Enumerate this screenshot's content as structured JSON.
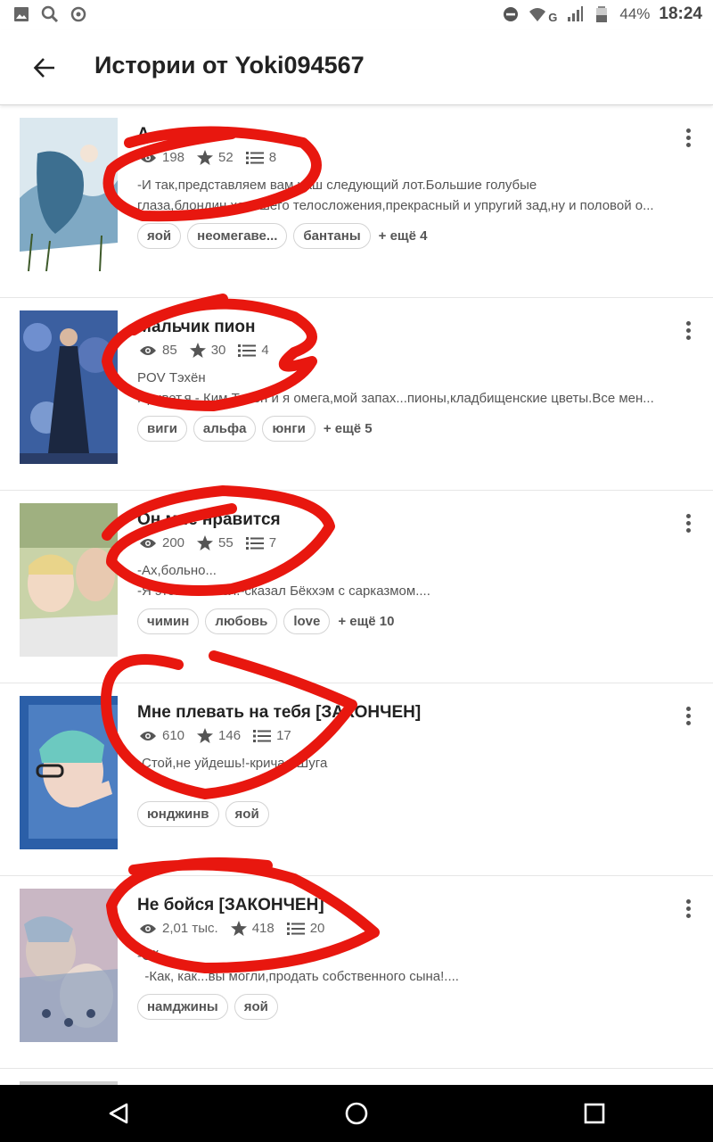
{
  "status_bar": {
    "battery": "44%",
    "time": "18:24",
    "network": "G"
  },
  "app_bar": {
    "title": "Истории от Yoki094567"
  },
  "stories": [
    {
      "title": "А...",
      "views": "198",
      "votes": "52",
      "parts": "8",
      "description": [
        "-И так,представляем вам наш следующий лот.Большие голубые",
        "глаза,блондин,хорошего телосложения,прекрасный и упругий зад,ну и половой о..."
      ],
      "tags": [
        "яой",
        "неомегаве...",
        "бантаны"
      ],
      "more_tags": "+ ещё 4",
      "cover_colors": [
        "#cfe0ea",
        "#6b9ab8",
        "#2f5f7f"
      ]
    },
    {
      "title": "Мальчик пион",
      "views": "85",
      "votes": "30",
      "parts": "4",
      "description": [
        "POV Тэхён",
        "Привет,я - Ким Тэхён и я омега,мой запах...пионы,кладбищенские цветы.Все мен..."
      ],
      "tags": [
        "виги",
        "альфа",
        "юнги"
      ],
      "more_tags": "+ ещё 5",
      "cover_colors": [
        "#3b5fa0",
        "#7b9ad0",
        "#1b2740"
      ]
    },
    {
      "title": "Он мне нравится",
      "views": "200",
      "votes": "55",
      "parts": "7",
      "description": [
        "-Ах,больно...",
        "-Я этого и хотел.-сказал Бёкхэм с сарказмом...."
      ],
      "tags": [
        "чимин",
        "любовь",
        "love"
      ],
      "more_tags": "+ ещё 10",
      "cover_colors": [
        "#c9d3a8",
        "#f2d9c4",
        "#e8e8e8"
      ]
    },
    {
      "title": "Мне плевать на тебя [ЗАКОНЧЕН]",
      "views": "610",
      "votes": "146",
      "parts": "17",
      "description": [
        "-Стой,не уйдешь!-кричал Шуга"
      ],
      "tags": [
        "юнджинв",
        "яой"
      ],
      "more_tags": "",
      "cover_colors": [
        "#2b5fa8",
        "#6cc9c0",
        "#f0d6c8"
      ]
    },
    {
      "title": "Не бойся [ЗАКОНЧЕН]",
      "views": "2,01 тыс.",
      "votes": "418",
      "parts": "20",
      "description": [
        "-Ой...",
        "  -Как, как...вы могли,продать собственного сына!...."
      ],
      "tags": [
        "намджины",
        "яой"
      ],
      "more_tags": "",
      "cover_colors": [
        "#c9b7c4",
        "#8fa3c0",
        "#e9d9d0"
      ]
    }
  ],
  "colors": {
    "scribble": "#e8170f",
    "text_primary": "#222222",
    "text_secondary": "#555555",
    "nav_bar": "#000000"
  },
  "icons": {
    "status_left": [
      "gallery-icon",
      "search-icon",
      "sync-icon"
    ],
    "status_right": [
      "dnd-icon",
      "wifi-icon",
      "signal-icon",
      "battery-icon"
    ],
    "nav": [
      "back-nav-icon",
      "home-nav-icon",
      "recents-nav-icon"
    ]
  }
}
